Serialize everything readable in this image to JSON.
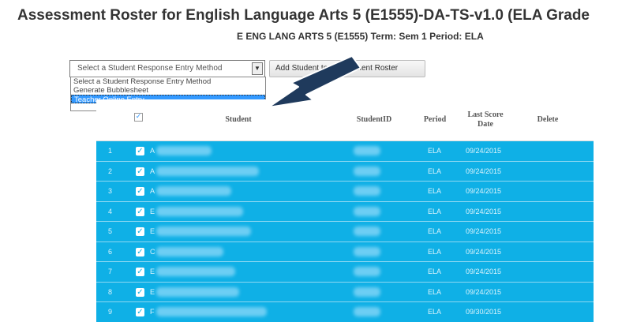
{
  "header": {
    "title": "Assessment Roster for English Language Arts 5 (E1555)-DA-TS-v1.0 (ELA Grade",
    "subtitle": "E ENG LANG ARTS 5 (E1555) Term: Sem 1 Period: ELA"
  },
  "controls": {
    "entry_method_selected": "Select a Student Response Entry Method",
    "add_button_label": "Add Student to Assessment Roster",
    "dropdown_options": [
      "Select a Student Response Entry Method",
      "Generate Bubblesheet",
      "Teacher Online Entry"
    ]
  },
  "table": {
    "headers": {
      "student": "Student",
      "student_id": "StudentID",
      "period": "Period",
      "last_score_date": "Last Score Date",
      "delete": "Delete"
    },
    "rows": [
      {
        "num": "1",
        "initial": "A",
        "period": "ELA",
        "date": "09/24/2015"
      },
      {
        "num": "2",
        "initial": "A",
        "period": "ELA",
        "date": "09/24/2015"
      },
      {
        "num": "3",
        "initial": "A",
        "period": "ELA",
        "date": "09/24/2015"
      },
      {
        "num": "4",
        "initial": "E",
        "period": "ELA",
        "date": "09/24/2015"
      },
      {
        "num": "5",
        "initial": "E",
        "period": "ELA",
        "date": "09/24/2015"
      },
      {
        "num": "6",
        "initial": "C",
        "period": "ELA",
        "date": "09/24/2015"
      },
      {
        "num": "7",
        "initial": "E",
        "period": "ELA",
        "date": "09/24/2015"
      },
      {
        "num": "8",
        "initial": "E",
        "period": "ELA",
        "date": "09/24/2015"
      },
      {
        "num": "9",
        "initial": "F",
        "period": "ELA",
        "date": "09/30/2015"
      }
    ]
  },
  "colors": {
    "row_bg": "#0fb0e6",
    "selected_option": "#3399ff",
    "arrow": "#1f3a5c"
  },
  "icons": {
    "dropdown_arrow": "chevron-down-icon",
    "checkbox": "checkbox-checked-icon",
    "pointer": "arrow-pointer-icon"
  }
}
